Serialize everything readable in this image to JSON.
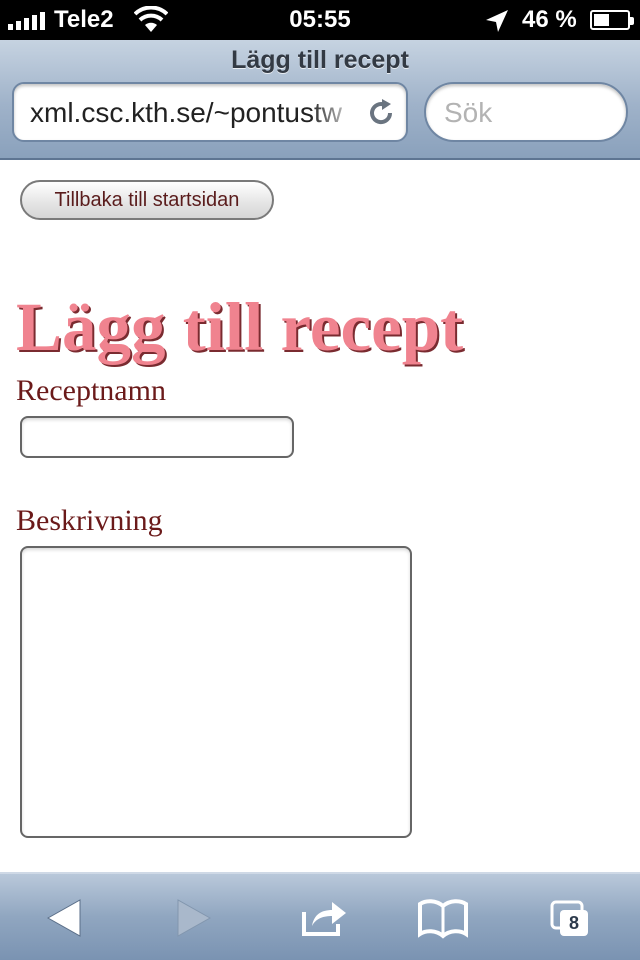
{
  "status_bar": {
    "carrier": "Tele2",
    "time": "05:55",
    "battery_percent": "46 %",
    "battery_level": 0.46
  },
  "browser": {
    "page_title": "Lägg till recept",
    "url": "xml.csc.kth.se/~pontustw",
    "search_placeholder": "Sök",
    "tabs_count": "8"
  },
  "page": {
    "back_button_label": "Tillbaka till startsidan",
    "heading": "Lägg till recept",
    "recipe_name_label": "Receptnamn",
    "recipe_name_value": "",
    "description_label": "Beskrivning",
    "description_value": ""
  },
  "colors": {
    "heading": "#f0838f",
    "label": "#6b1a1a"
  }
}
